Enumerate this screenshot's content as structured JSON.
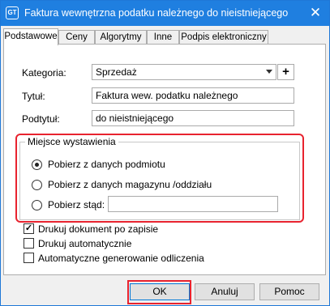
{
  "window": {
    "title": "Faktura wewnętrzna podatku należnego do nieistniejącego",
    "icon": "app-logo-icon",
    "icon_text": "GT",
    "close_glyph": "✕"
  },
  "tabs": [
    {
      "label": "Podstawowe",
      "active": true
    },
    {
      "label": "Ceny",
      "active": false
    },
    {
      "label": "Algorytmy",
      "active": false
    },
    {
      "label": "Inne",
      "active": false
    },
    {
      "label": "Podpis elektroniczny",
      "active": false
    }
  ],
  "form": {
    "kategoria_label": "Kategoria:",
    "kategoria_value": "Sprzedaż",
    "add_glyph": "+",
    "tytul_label": "Tytuł:",
    "tytul_value": "Faktura wew. podatku należnego",
    "podtytul_label": "Podtytuł:",
    "podtytul_value": "do nieistniejącego"
  },
  "miejsce": {
    "title": "Miejsce wystawienia",
    "options": [
      {
        "label": "Pobierz z danych podmiotu",
        "selected": true
      },
      {
        "label": "Pobierz z danych magazynu /oddziału",
        "selected": false
      },
      {
        "label": "Pobierz stąd:",
        "selected": false
      }
    ],
    "stad_value": ""
  },
  "checkboxes": [
    {
      "label": "Drukuj dokument po zapisie",
      "checked": true
    },
    {
      "label": "Drukuj automatycznie",
      "checked": false
    },
    {
      "label": "Automatyczne generowanie odliczenia",
      "checked": false
    }
  ],
  "check_glyph": "✓",
  "buttons": {
    "ok": "OK",
    "cancel": "Anuluj",
    "help": "Pomoc"
  },
  "colors": {
    "titlebar": "#1f7fe0",
    "highlight": "#e8232f"
  }
}
